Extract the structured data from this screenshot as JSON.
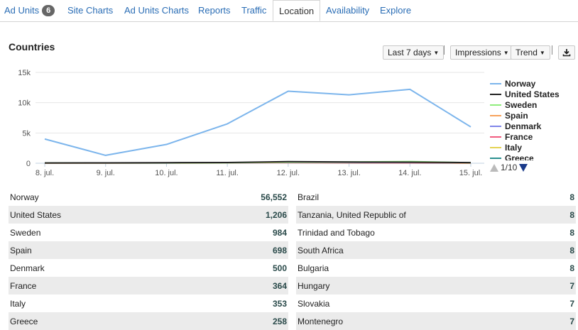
{
  "tabs": [
    {
      "label": "Ad Units",
      "badge": "6"
    },
    {
      "label": "Site Charts"
    },
    {
      "label": "Ad Units Charts"
    },
    {
      "label": "Reports"
    },
    {
      "label": "Traffic"
    },
    {
      "label": "Location"
    },
    {
      "label": "Availability"
    },
    {
      "label": "Explore"
    }
  ],
  "active_tab": "Location",
  "section_title": "Countries",
  "controls": {
    "period": "Last 7 days",
    "metric": "Impressions",
    "view": "Trend",
    "download_icon": "download-icon"
  },
  "chart_data": {
    "type": "line",
    "x": [
      "8. jul.",
      "9. jul.",
      "10. jul.",
      "11. jul.",
      "12. jul.",
      "13. jul.",
      "14. jul.",
      "15. jul."
    ],
    "y_ticks": [
      "15k",
      "10k",
      "5k",
      "0"
    ],
    "ylim": [
      0,
      15000
    ],
    "series": [
      {
        "name": "Norway",
        "color": "#7cb5ec",
        "values": [
          4000,
          1300,
          3100,
          6500,
          11900,
          11300,
          12200,
          6000
        ]
      },
      {
        "name": "United States",
        "color": "#222222",
        "values": [
          50,
          60,
          90,
          120,
          260,
          200,
          180,
          100
        ]
      },
      {
        "name": "Sweden",
        "color": "#90ed7d",
        "values": [
          40,
          50,
          60,
          90,
          180,
          200,
          280,
          90
        ]
      },
      {
        "name": "Spain",
        "color": "#f7a35c",
        "values": [
          30,
          40,
          60,
          80,
          140,
          160,
          150,
          50
        ]
      },
      {
        "name": "Denmark",
        "color": "#8085e9",
        "values": [
          30,
          40,
          50,
          70,
          100,
          110,
          120,
          40
        ]
      },
      {
        "name": "France",
        "color": "#f15c80",
        "values": [
          20,
          30,
          40,
          60,
          80,
          70,
          60,
          30
        ]
      },
      {
        "name": "Italy",
        "color": "#e4d354",
        "values": [
          20,
          30,
          40,
          60,
          80,
          70,
          60,
          30
        ]
      },
      {
        "name": "Greece",
        "color": "#2b908f",
        "values": [
          20,
          20,
          30,
          50,
          60,
          50,
          40,
          20
        ]
      }
    ]
  },
  "legend_pager": "1/10",
  "table_left": [
    {
      "country": "Norway",
      "value": "56,552"
    },
    {
      "country": "United States",
      "value": "1,206"
    },
    {
      "country": "Sweden",
      "value": "984"
    },
    {
      "country": "Spain",
      "value": "698"
    },
    {
      "country": "Denmark",
      "value": "500"
    },
    {
      "country": "France",
      "value": "364"
    },
    {
      "country": "Italy",
      "value": "353"
    },
    {
      "country": "Greece",
      "value": "258"
    }
  ],
  "table_right": [
    {
      "country": "Brazil",
      "value": "8"
    },
    {
      "country": "Tanzania, United Republic of",
      "value": "8"
    },
    {
      "country": "Trinidad and Tobago",
      "value": "8"
    },
    {
      "country": "South Africa",
      "value": "8"
    },
    {
      "country": "Bulgaria",
      "value": "8"
    },
    {
      "country": "Hungary",
      "value": "7"
    },
    {
      "country": "Slovakia",
      "value": "7"
    },
    {
      "country": "Montenegro",
      "value": "7"
    }
  ]
}
